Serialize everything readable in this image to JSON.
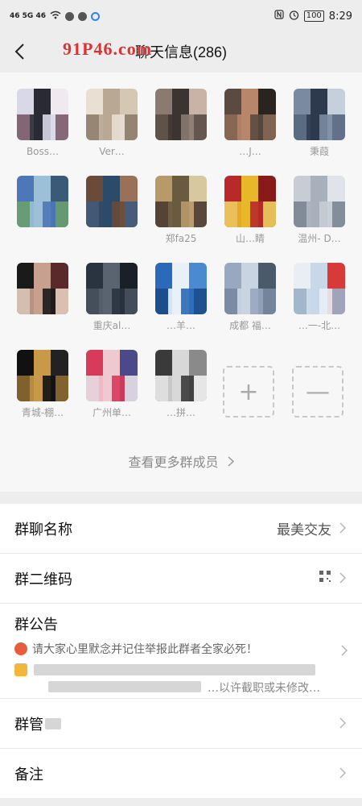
{
  "status_bar": {
    "left_text": "46 5G 46",
    "time": "8:29",
    "battery": "100"
  },
  "header": {
    "title": "聊天信息(286)",
    "watermark": "91P46.com"
  },
  "members": [
    {
      "name": "Boss…",
      "colors": [
        "#d8d8e8",
        "#2a2a35",
        "#f0eaf0",
        "#7a5a6a"
      ]
    },
    {
      "name": "Ver…",
      "colors": [
        "#e9dfd2",
        "#b8a894",
        "#d4c7b4",
        "#8e7c6a"
      ]
    },
    {
      "name": "",
      "colors": [
        "#8a7a70",
        "#3c3430",
        "#c9b3a6",
        "#5a4d45"
      ]
    },
    {
      "name": "…J…",
      "colors": [
        "#5a4a40",
        "#b8866a",
        "#2a2420",
        "#8a6a55"
      ]
    },
    {
      "name": "秉葭",
      "colors": [
        "#7a8aa0",
        "#2d3a4e",
        "#c6d0dc",
        "#56687f"
      ]
    },
    {
      "name": "",
      "colors": [
        "#4c78b8",
        "#9cc0d8",
        "#3a5a78",
        "#6aa070"
      ]
    },
    {
      "name": "",
      "colors": [
        "#6a4a38",
        "#2c4a6a",
        "#9a7058",
        "#3d5a7d"
      ]
    },
    {
      "name": "郑fa25",
      "colors": [
        "#b89a6a",
        "#6a5a40",
        "#d8c8a0",
        "#4a3a30"
      ]
    },
    {
      "name": "山…睛",
      "colors": [
        "#b82a2a",
        "#e8b82a",
        "#8a1a1a",
        "#f0d060"
      ]
    },
    {
      "name": "温州- D…",
      "colors": [
        "#c8ccd4",
        "#a8b0bc",
        "#e0e4ea",
        "#7a8492"
      ]
    },
    {
      "name": "",
      "colors": [
        "#1a1a1a",
        "#c8a090",
        "#5a2a2a",
        "#e8d0c0"
      ]
    },
    {
      "name": "重庆al…",
      "colors": [
        "#2a3440",
        "#5a6470",
        "#1a2028",
        "#48525e"
      ]
    },
    {
      "name": "…羊…",
      "colors": [
        "#2a6ab8",
        "#e8f0f8",
        "#4a8ad0",
        "#1a4a88"
      ]
    },
    {
      "name": "成都 福…",
      "colors": [
        "#98a8c0",
        "#c8d4e2",
        "#4a5a6a",
        "#7888a0"
      ]
    },
    {
      "name": "…一-北…",
      "colors": [
        "#e8eef4",
        "#c8d8e8",
        "#d83a3a",
        "#9ab0c8"
      ]
    },
    {
      "name": "青城-棚…",
      "colors": [
        "#111111",
        "#c89a48",
        "#222222",
        "#8a6a30"
      ]
    },
    {
      "name": "广州单…",
      "colors": [
        "#d83a5a",
        "#f0c8d0",
        "#4a4a8a",
        "#e8e0e8"
      ]
    },
    {
      "name": "…拼…",
      "colors": [
        "#3a3a3a",
        "#d8d8d8",
        "#8a8a8a",
        "#f0f0f0"
      ]
    }
  ],
  "add_member": {
    "label": "+"
  },
  "remove_member": {
    "label": "—"
  },
  "more_members": "查看更多群成员",
  "settings": {
    "group_name": {
      "label": "群聊名称",
      "value": "最美交友"
    },
    "qr_code": {
      "label": "群二维码"
    },
    "announcement": {
      "label": "群公告",
      "line1": "请大家心里默念并记住举报此群者全家必死！",
      "line3": "…以许截职或未修改…"
    },
    "manage": {
      "label": "群管"
    },
    "notes": {
      "label": "备注"
    }
  },
  "colors": {
    "background": "#ededed",
    "panel": "#f7f7f7",
    "card": "#ffffff",
    "watermark": "#e03030"
  }
}
